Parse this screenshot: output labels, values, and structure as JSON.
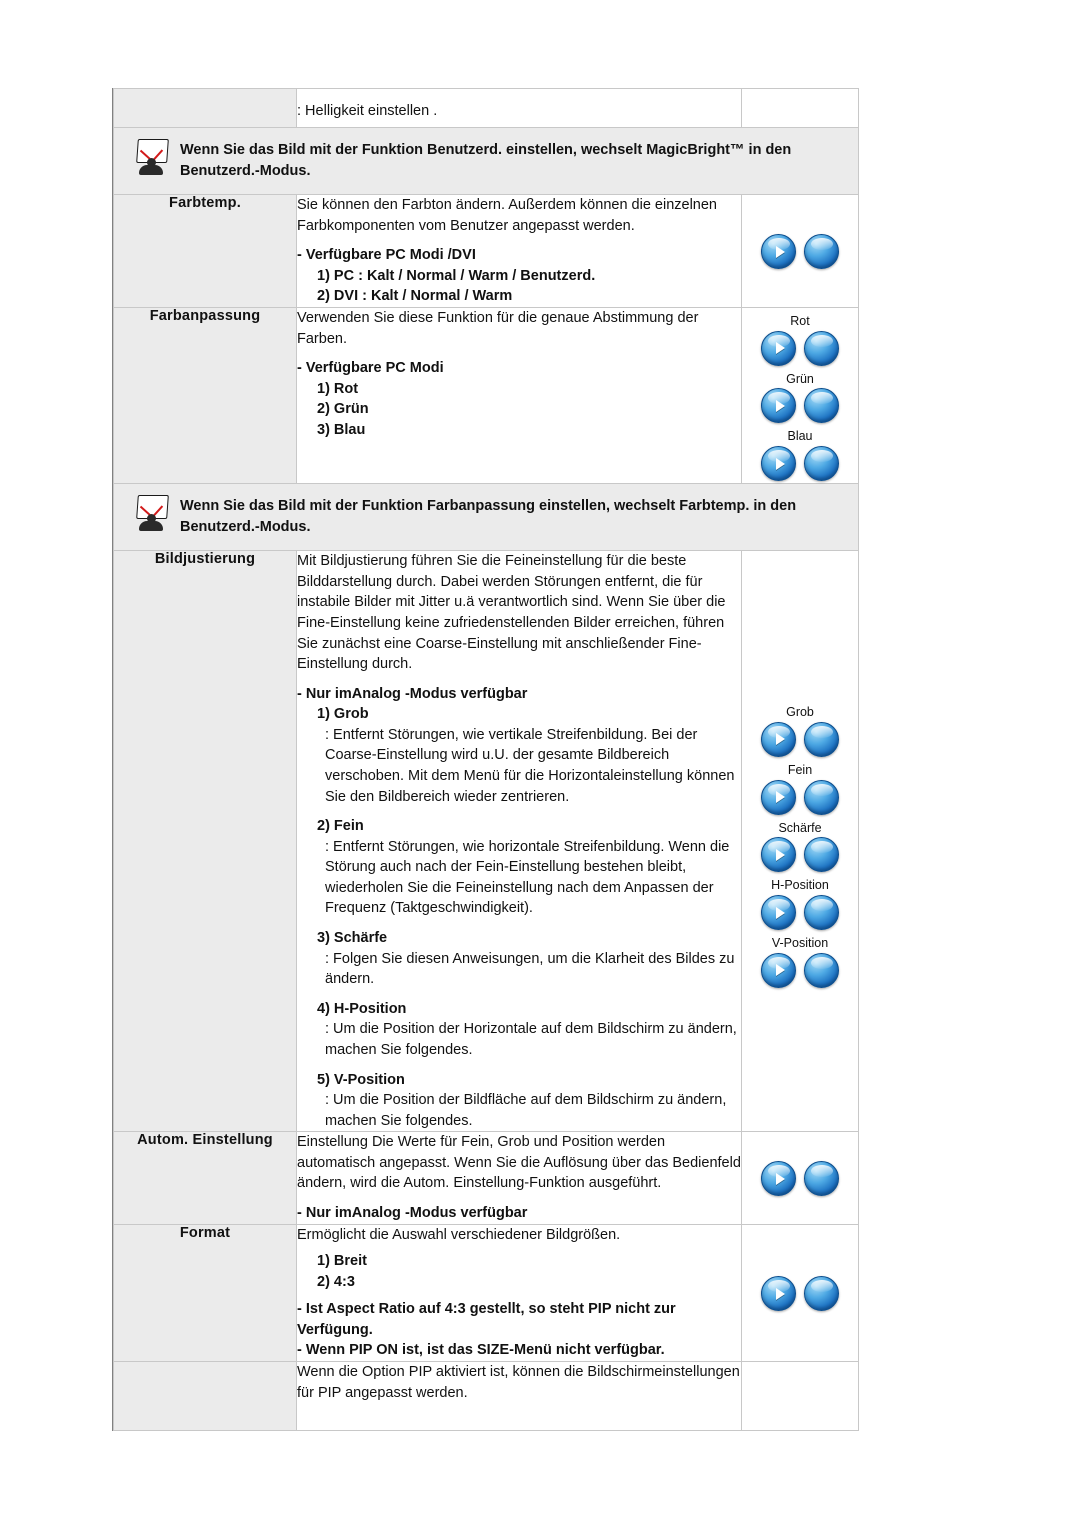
{
  "top_row": {
    "text": ": Helligkeit einstellen ."
  },
  "notes": [
    {
      "icon": "note-icon",
      "text": "Wenn Sie das Bild mit der Funktion Benutzerd. einstellen, wechselt MagicBright™ in den Benutzerd.-Modus."
    },
    {
      "icon": "note-icon",
      "text": "Wenn Sie das Bild mit der Funktion Farbanpassung einstellen, wechselt Farbtemp. in den Benutzerd.-Modus."
    }
  ],
  "rows": {
    "farbtemp": {
      "label": "Farbtemp.",
      "para1": "Sie können den Farbton ändern. Außerdem können die einzelnen Farbkomponenten vom Benutzer angepasst werden.",
      "head": "- Verfügbare PC Modi /DVI",
      "item1": "1) PC : Kalt / Normal / Warm / Benutzerd.",
      "item2": "2) DVI : Kalt / Normal / Warm"
    },
    "farbanpassung": {
      "label": "Farbanpassung",
      "para1": "Verwenden Sie diese Funktion für die genaue Abstimmung der Farben.",
      "head": "- Verfügbare PC Modi",
      "item1": "1) Rot",
      "item2": "2) Grün",
      "item3": "3) Blau",
      "ctrl_labels": [
        "Rot",
        "Grün",
        "Blau"
      ]
    },
    "bildjustierung": {
      "label": "Bildjustierung",
      "para1": "Mit Bildjustierung führen Sie die Feineinstellung für die beste Bilddarstellung durch. Dabei werden Störungen entfernt, die für instabile Bilder mit Jitter u.ä verantwortlich sind. Wenn Sie über die Fine-Einstellung keine zufriedenstellenden Bilder erreichen, führen Sie zunächst eine Coarse-Einstellung mit anschließender Fine-Einstellung durch.",
      "head": "- Nur imAnalog -Modus verfügbar",
      "item1": "1) Grob",
      "item1_desc": ": Entfernt Störungen, wie vertikale Streifenbildung. Bei der Coarse-Einstellung wird u.U. der gesamte Bildbereich verschoben. Mit dem Menü für die Horizontaleinstellung können Sie den Bildbereich wieder zentrieren.",
      "item2": "2) Fein",
      "item2_desc": ": Entfernt Störungen, wie horizontale Streifenbildung. Wenn die Störung auch nach der Fein-Einstellung bestehen bleibt, wiederholen Sie die Feineinstellung nach dem Anpassen der Frequenz (Taktgeschwindigkeit).",
      "item3": "3) Schärfe",
      "item3_desc": ": Folgen Sie diesen Anweisungen, um die Klarheit des Bildes zu ändern.",
      "item4": "4) H-Position",
      "item4_desc": ": Um die Position der Horizontale auf dem Bildschirm zu ändern, machen Sie folgendes.",
      "item5": "5) V-Position",
      "item5_desc": ": Um die Position der Bildfläche auf dem Bildschirm zu ändern, machen Sie folgendes.",
      "ctrl_labels": [
        "Grob",
        "Fein",
        "Schärfe",
        "H-Position",
        "V-Position"
      ]
    },
    "autom": {
      "label": "Autom. Einstellung",
      "para1": "Einstellung Die Werte für Fein, Grob und Position werden automatisch angepasst. Wenn Sie die Auflösung über das Bedienfeld ändern, wird die Autom. Einstellung-Funktion ausgeführt.",
      "head": "- Nur imAnalog -Modus verfügbar"
    },
    "format": {
      "label": "Format",
      "para1": "Ermöglicht die Auswahl verschiedener Bildgrößen.",
      "item1": "1) Breit",
      "item2": "2) 4:3",
      "note1": "- Ist Aspect Ratio auf 4:3 gestellt, so steht PIP nicht zur Verfügung.",
      "note2": "- Wenn PIP ON ist, ist das SIZE-Menü nicht verfügbar."
    },
    "last": {
      "text": "Wenn die Option PIP aktiviert ist, können die Bildschirmeinstellungen für PIP angepasst werden."
    }
  },
  "colors": {
    "label_bg": "#ebebeb",
    "note_bg": "#ebebeb",
    "border": "#c8c8c8",
    "button_blue": "#1b6fc0",
    "check_red": "#d21a1a"
  }
}
